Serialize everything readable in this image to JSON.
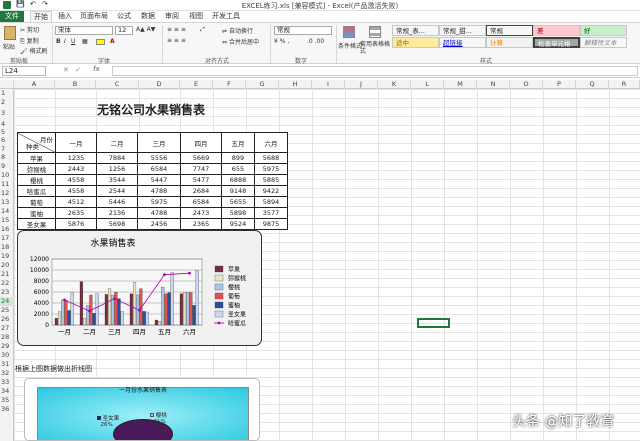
{
  "window": {
    "title": "EXCEL练习.xls [兼容模式] - Excel(产品激活失败)"
  },
  "tabs": [
    "文件",
    "开始",
    "插入",
    "页面布局",
    "公式",
    "数据",
    "审阅",
    "视图",
    "开发工具"
  ],
  "ribbon": {
    "clipboard": {
      "paste": "粘贴",
      "cut": "剪切",
      "copy": "复制",
      "format_painter": "格式刷",
      "label": "剪贴板"
    },
    "font": {
      "name": "宋体",
      "size": "12",
      "label": "字体"
    },
    "alignment": {
      "wrap": "自动换行",
      "merge": "合并后居中",
      "label": "对齐方式"
    },
    "number": {
      "format": "常规",
      "label": "数字"
    },
    "styles": {
      "cond_format": "条件格式",
      "table_format": "套用表格格式",
      "label": "样式",
      "cells": [
        {
          "name": "常规_表...",
          "bg": "#ffffff"
        },
        {
          "name": "常规_甜...",
          "bg": "#ffffff"
        },
        {
          "name": "常规",
          "bg": "#ffffff"
        },
        {
          "name": "差",
          "bg": "#ffc7ce"
        },
        {
          "name": "好",
          "bg": "#c6efce"
        },
        {
          "name": "适中",
          "bg": "#ffeb9c"
        },
        {
          "name": "超链接",
          "bg": "#ffffff"
        },
        {
          "name": "计算",
          "bg": "#f2f2f2"
        },
        {
          "name": "检查单元格",
          "bg": "#a5a5a5"
        },
        {
          "name": "解释性文本",
          "bg": "#ffffff"
        }
      ]
    }
  },
  "formula_bar": {
    "name_box": "L24",
    "fx": "fx",
    "content": ""
  },
  "columns": [
    "A",
    "B",
    "C",
    "D",
    "E",
    "F",
    "G",
    "H",
    "I",
    "J",
    "K",
    "L",
    "M",
    "N",
    "O",
    "P",
    "Q",
    "R"
  ],
  "rows": [
    "1",
    "2",
    "3",
    "4",
    "5",
    "6",
    "7",
    "8",
    "9",
    "10",
    "11",
    "12",
    "13",
    "14",
    "15",
    "16",
    "17",
    "18",
    "19",
    "20",
    "21",
    "22",
    "23",
    "24",
    "25",
    "26",
    "27",
    "28",
    "29",
    "30",
    "31",
    "32",
    "33",
    "34",
    "35",
    "36"
  ],
  "sheet": {
    "title": "无铭公司水果销售表",
    "corner_top": "月份",
    "corner_bottom": "种类",
    "months": [
      "一月",
      "二月",
      "三月",
      "四月",
      "五月",
      "六月"
    ],
    "rows": [
      {
        "name": "苹果",
        "values": [
          "1235",
          "7884",
          "5556",
          "5669",
          "899",
          "5688"
        ]
      },
      {
        "name": "弥猴桃",
        "values": [
          "2443",
          "1256",
          "6584",
          "7747",
          "655",
          "5975"
        ]
      },
      {
        "name": "樱桃",
        "values": [
          "4558",
          "3544",
          "5447",
          "5477",
          "6888",
          "5885"
        ]
      },
      {
        "name": "哈蜜瓜",
        "values": [
          "4558",
          "2544",
          "4788",
          "2684",
          "9148",
          "9422"
        ]
      },
      {
        "name": "葡萄",
        "values": [
          "4512",
          "5446",
          "5975",
          "6584",
          "5655",
          "5894"
        ]
      },
      {
        "name": "蜜柚",
        "values": [
          "2635",
          "2136",
          "4788",
          "2473",
          "5898",
          "3577"
        ]
      },
      {
        "name": "圣女果",
        "values": [
          "5876",
          "5698",
          "2456",
          "2365",
          "9524",
          "9875"
        ]
      }
    ],
    "note": "根据上图数据做出折线图"
  },
  "chart_data": [
    {
      "type": "bar",
      "title": "水果销售表",
      "categories": [
        "一月",
        "二月",
        "三月",
        "四月",
        "五月",
        "六月"
      ],
      "ylim": [
        0,
        12000
      ],
      "yticks": [
        0,
        2000,
        4000,
        6000,
        8000,
        10000,
        12000
      ],
      "legend": "right",
      "series": [
        {
          "name": "苹果",
          "color": "#7b2c3f",
          "values": [
            1235,
            7884,
            5556,
            5669,
            899,
            5688
          ]
        },
        {
          "name": "弥猴桃",
          "color": "#e8e6c8",
          "values": [
            2443,
            1256,
            6584,
            7747,
            655,
            5975
          ]
        },
        {
          "name": "樱桃",
          "color": "#a8c8e8",
          "values": [
            4558,
            3544,
            5447,
            5477,
            6888,
            5885
          ]
        },
        {
          "name": "葡萄",
          "color": "#e85050",
          "values": [
            4512,
            5446,
            5975,
            6584,
            5655,
            5894
          ]
        },
        {
          "name": "蜜柚",
          "color": "#2a4fa0",
          "values": [
            2635,
            2136,
            4788,
            2473,
            5898,
            3577
          ]
        },
        {
          "name": "圣女果",
          "color": "#c8d8f0",
          "values": [
            5876,
            5698,
            2456,
            2365,
            9524,
            9875
          ]
        },
        {
          "name": "哈蜜瓜",
          "color": "#b000b0",
          "line": true,
          "values": [
            4558,
            2544,
            4788,
            2684,
            9148,
            9422
          ]
        }
      ]
    },
    {
      "type": "pie",
      "title": "一月份水果销售表",
      "labels": [
        {
          "name": "圣女果",
          "pct": "26%"
        },
        {
          "name": "樱桃",
          "pct": "21%"
        }
      ]
    }
  ],
  "watermark": "头条 @知了教育"
}
